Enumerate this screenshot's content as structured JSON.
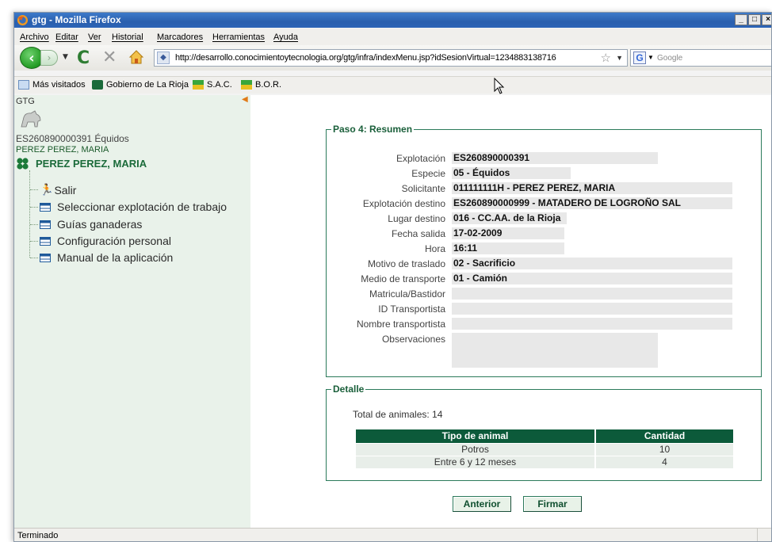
{
  "window": {
    "title": "gtg - Mozilla Firefox"
  },
  "menu": {
    "items": [
      "Archivo",
      "Editar",
      "Ver",
      "Historial",
      "Marcadores",
      "Herramientas",
      "Ayuda"
    ]
  },
  "navbar": {
    "url": "http://desarrollo.conocimientoytecnologia.org/gtg/infra/indexMenu.jsp?idSesionVirtual=1234883138716",
    "search_placeholder": "Google"
  },
  "bookmarks": {
    "items": [
      "Más visitados",
      "Gobierno de La Rioja",
      "S.A.C.",
      "B.O.R."
    ]
  },
  "sidebar": {
    "app_label": "GTG",
    "exploitation": "ES260890000391 Équidos",
    "owner_small": "PEREZ PEREZ, MARIA",
    "owner_big": "PEREZ PEREZ, MARIA",
    "tree": [
      "Salir",
      "Seleccionar explotación de trabajo",
      "Guías ganaderas",
      "Configuración personal",
      "Manual de la aplicación"
    ]
  },
  "summary": {
    "legend": "Paso 4: Resumen",
    "fields": [
      {
        "label": "Explotación",
        "value": "ES260890000391"
      },
      {
        "label": "Especie",
        "value": "05 - Équidos"
      },
      {
        "label": "Solicitante",
        "value": "011111111H - PEREZ PEREZ, MARIA"
      },
      {
        "label": "Explotación destino",
        "value": "ES260890000999 - MATADERO DE LOGROÑO SAL"
      },
      {
        "label": "Lugar destino",
        "value": "016 - CC.AA. de la Rioja"
      },
      {
        "label": "Fecha salida",
        "value": "17-02-2009"
      },
      {
        "label": "Hora",
        "value": "16:11"
      },
      {
        "label": "Motivo de traslado",
        "value": "02 - Sacrificio"
      },
      {
        "label": "Medio de transporte",
        "value": "01 - Camión"
      },
      {
        "label": "Matricula/Bastidor",
        "value": ""
      },
      {
        "label": "ID Transportista",
        "value": ""
      },
      {
        "label": "Nombre transportista",
        "value": ""
      },
      {
        "label": "Observaciones",
        "value": ""
      }
    ]
  },
  "detail": {
    "legend": "Detalle",
    "total": "Total de animales: 14",
    "columns": [
      "Tipo de animal",
      "Cantidad"
    ],
    "rows": [
      [
        "Potros",
        "10"
      ],
      [
        "Entre 6 y 12 meses",
        "4"
      ]
    ]
  },
  "buttons": {
    "previous": "Anterior",
    "sign": "Firmar"
  },
  "status": {
    "text": "Terminado"
  },
  "colors": {
    "accent": "#0c5a3a",
    "sidebar_bg": "#e9f2ea",
    "field_bg": "#e8e8e8"
  }
}
